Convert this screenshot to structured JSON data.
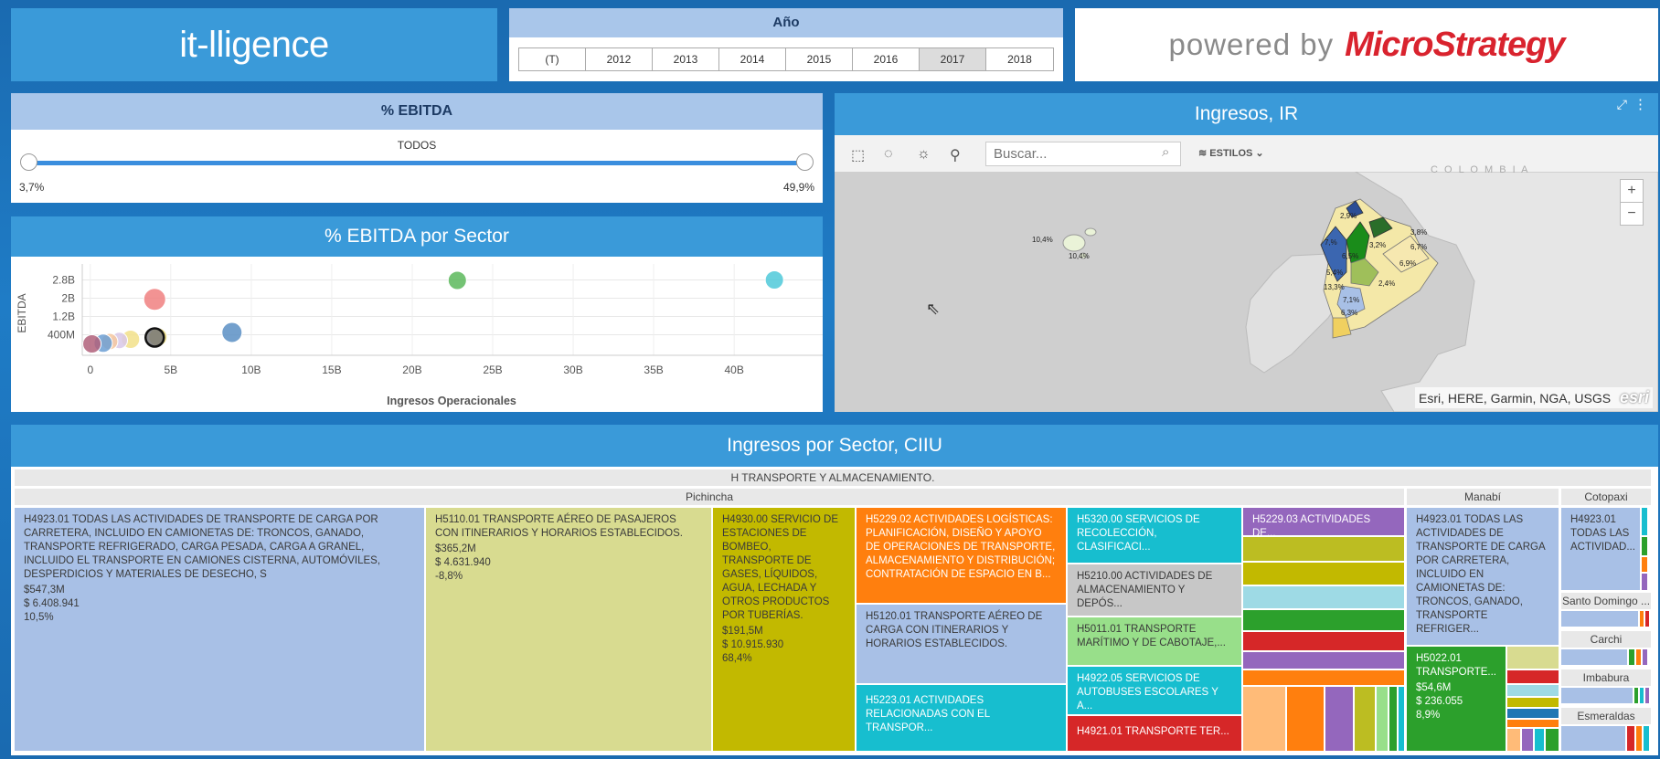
{
  "logo": "it-lligence",
  "year": {
    "title": "Año",
    "options": [
      "(T)",
      "2012",
      "2013",
      "2014",
      "2015",
      "2016",
      "2017",
      "2018"
    ],
    "selected": "2017"
  },
  "powered": {
    "prefix": "powered by",
    "brand": "MicroStrategy"
  },
  "ebitda_filter": {
    "title": "% EBITDA",
    "label": "TODOS",
    "min": "3,7%",
    "max": "49,9%"
  },
  "scatter": {
    "title": "% EBITDA por Sector",
    "ylabel": "EBITDA",
    "xlabel": "Ingresos Operacionales",
    "yticks": [
      "2.8B",
      "2B",
      "1.2B",
      "400M"
    ],
    "xticks": [
      "0",
      "5B",
      "10B",
      "15B",
      "20B",
      "25B",
      "30B",
      "35B",
      "40B"
    ]
  },
  "chart_data": {
    "type": "scatter",
    "title": "% EBITDA por Sector",
    "xlabel": "Ingresos Operacionales",
    "ylabel": "EBITDA",
    "xlim": [
      -0.5,
      45.5
    ],
    "ylim": [
      -0.5,
      3.5
    ],
    "x_unit": "B",
    "y_unit": "B",
    "points": [
      {
        "x": 42.5,
        "y": 2.8,
        "color": "#4fc9d9",
        "r": 10
      },
      {
        "x": 22.8,
        "y": 2.78,
        "color": "#5cb85c",
        "r": 10
      },
      {
        "x": 4.0,
        "y": 1.95,
        "color": "#f08080",
        "r": 12
      },
      {
        "x": 8.8,
        "y": 0.5,
        "color": "#5a8fc4",
        "r": 11
      },
      {
        "x": 4.2,
        "y": 0.3,
        "color": "#e8d878",
        "r": 10
      },
      {
        "x": 4.0,
        "y": 0.28,
        "color": "#777777",
        "r": 10,
        "outline": true
      },
      {
        "x": 2.5,
        "y": 0.2,
        "color": "#f2e08a",
        "r": 10
      },
      {
        "x": 1.8,
        "y": 0.15,
        "color": "#d8c8e8",
        "r": 9
      },
      {
        "x": 1.2,
        "y": 0.1,
        "color": "#f6c8a0",
        "r": 9
      },
      {
        "x": 0.8,
        "y": 0.03,
        "color": "#6c9fd4",
        "r": 10
      },
      {
        "x": 0.1,
        "y": 0.0,
        "color": "#b0607a",
        "r": 10
      }
    ]
  },
  "map": {
    "title": "Ingresos, IR",
    "search_placeholder": "Buscar...",
    "styles_label": "ESTILOS",
    "country_label": "C O L O M B I A",
    "attribution": "Esri, HERE, Garmin, NGA, USGS",
    "esri": "esri",
    "labels": [
      "10,4%",
      "10,4%",
      "2,9%",
      "3,2%",
      "3,8%",
      "6,7%",
      "6,9%",
      "6,5%",
      "5,4%",
      "7,%",
      "2,4%",
      "13,3%",
      "7,1%",
      "6,3%"
    ]
  },
  "treemap": {
    "title": "Ingresos por Sector, CIIU",
    "sector": "H TRANSPORTE Y ALMACENAMIENTO.",
    "provinces": [
      "Pichincha",
      "Manabí",
      "Cotopaxi",
      "Santo Domingo ...",
      "Carchi",
      "Imbabura",
      "Esmeraldas"
    ],
    "tiles": [
      {
        "title": "H4923.01 TODAS LAS ACTIVIDADES DE TRANSPORTE DE CARGA POR CARRETERA, INCLUIDO EN CAMIONETAS DE: TRONCOS, GANADO, TRANSPORTE REFRIGERADO, CARGA PESADA, CARGA A GRANEL, INCLUIDO EL TRANSPORTE EN CAMIONES CISTERNA, AUTOMÓVILES, DESPERDICIOS Y MATERIALES DE DESECHO, S",
        "v1": "$547,3M",
        "v2": "$ 6.408.941",
        "v3": "10,5%"
      },
      {
        "title": "H5110.01 TRANSPORTE AÉREO DE PASAJEROS CON ITINERARIOS Y HORARIOS ESTABLECIDOS.",
        "v1": "$365,2M",
        "v2": "$ 4.631.940",
        "v3": "-8,8%"
      },
      {
        "title": "H4930.00 SERVICIO DE ESTACIONES DE BOMBEO, TRANSPORTE DE GASES, LÍQUIDOS, AGUA, LECHADA Y OTROS PRODUCTOS POR TUBERÍAS.",
        "v1": "$191,5M",
        "v2": "$ 10.915.930",
        "v3": "68,4%"
      },
      {
        "title": "H5229.02 ACTIVIDADES LOGÍSTICAS: PLANIFICACIÓN, DISEÑO Y APOYO DE OPERACIONES DE TRANSPORTE, ALMACENAMIENTO Y DISTRIBUCIÓN; CONTRATACIÓN DE ESPACIO EN B..."
      },
      {
        "title": "H5120.01 TRANSPORTE AÉREO DE CARGA CON ITINERARIOS Y HORARIOS ESTABLECIDOS."
      },
      {
        "title": "H5223.01 ACTIVIDADES RELACIONADAS CON EL TRANSPOR..."
      },
      {
        "title": "H5320.00 SERVICIOS DE RECOLECCIÓN, CLASIFICACI..."
      },
      {
        "title": "H5210.00 ACTIVIDADES DE ALMACENAMIENTO Y DEPÓS..."
      },
      {
        "title": "H5011.01 TRANSPORTE MARÍTIMO Y DE CABOTAJE,..."
      },
      {
        "title": "H4922.05 SERVICIOS DE AUTOBUSES ESCOLARES Y A..."
      },
      {
        "title": "H4921.01 TRANSPORTE TER..."
      },
      {
        "title": "H5229.03 ACTIVIDADES DE..."
      },
      {
        "title": "H4923.01 TODAS LAS ACTIVIDADES DE TRANSPORTE DE CARGA POR CARRETERA, INCLUIDO EN CAMIONETAS DE: TRONCOS, GANADO, TRANSPORTE REFRIGER..."
      },
      {
        "title": "H5022.01 TRANSPORTE...",
        "v1": "$54,6M",
        "v2": "$ 236.055",
        "v3": "8,9%"
      },
      {
        "title": "H4923.01 TODAS LAS ACTIVIDAD..."
      }
    ]
  },
  "colors": {
    "header_blue": "#3a9ad9",
    "light_blue": "#a9c6ea",
    "tile_blue": "#a8c0e6",
    "tile_khaki": "#d8db90",
    "tile_olive": "#c2b900",
    "tile_orange": "#ff7f0e",
    "tile_cyan": "#17becf",
    "tile_gray": "#c7c7c7",
    "tile_green": "#98df8a",
    "tile_red": "#d62728",
    "tile_purple": "#9467bd",
    "tile_dkgreen": "#2ca02c"
  }
}
